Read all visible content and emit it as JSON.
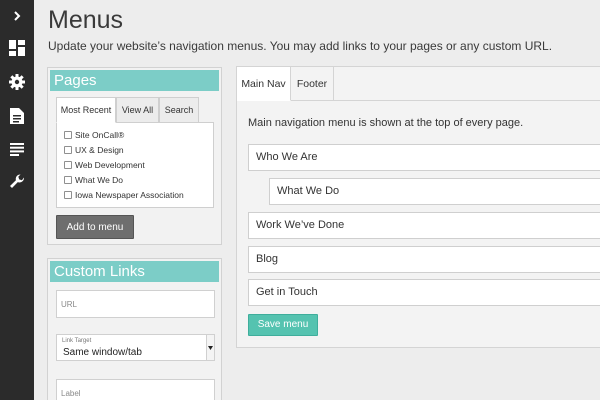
{
  "sidebar": {
    "items": [
      {
        "icon": "chevron-right-icon"
      },
      {
        "icon": "dashboard-icon"
      },
      {
        "icon": "gear-icon"
      },
      {
        "icon": "document-icon"
      },
      {
        "icon": "list-icon"
      },
      {
        "icon": "wrench-icon"
      }
    ]
  },
  "header": {
    "title": "Menus",
    "description": "Update your website’s navigation menus. You may add links to your pages or any custom URL."
  },
  "pages_panel": {
    "title": "Pages",
    "tabs": [
      "Most Recent",
      "View All",
      "Search"
    ],
    "active_tab": "Most Recent",
    "items": [
      {
        "label": "Site OnCall®",
        "checked": false
      },
      {
        "label": "UX & Design",
        "checked": false
      },
      {
        "label": "Web Development",
        "checked": false
      },
      {
        "label": "What We Do",
        "checked": false
      },
      {
        "label": "Iowa Newspaper Association",
        "checked": false
      }
    ],
    "add_button": "Add to menu"
  },
  "custom_links": {
    "title": "Custom Links",
    "url_placeholder": "URL",
    "link_target_label": "Link Target",
    "link_target_value": "Same window/tab",
    "label_placeholder": "Label"
  },
  "nav_editor": {
    "tabs": [
      "Main Nav",
      "Footer"
    ],
    "active_tab": "Main Nav",
    "description": "Main navigation menu is shown at the top of every page.",
    "items": [
      {
        "label": "Who We Are",
        "depth": 0
      },
      {
        "label": "What We Do",
        "depth": 1
      },
      {
        "label": "Work We’ve Done",
        "depth": 0
      },
      {
        "label": "Blog",
        "depth": 0
      },
      {
        "label": "Get in Touch",
        "depth": 0
      }
    ],
    "save_button": "Save menu"
  },
  "colors": {
    "accent": "#7ccdc7",
    "save_button": "#55c3b0",
    "sidebar_bg": "#2b2b2b",
    "add_button": "#6e6e6e"
  }
}
